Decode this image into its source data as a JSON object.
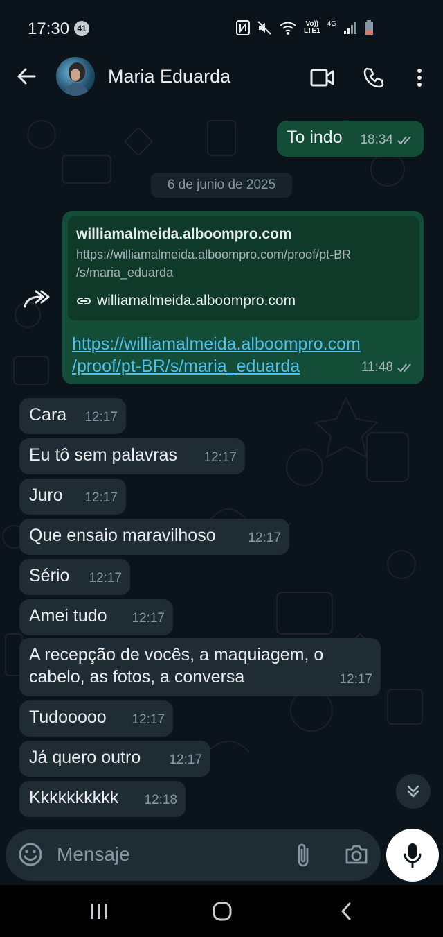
{
  "status": {
    "time": "17:30",
    "badge": "41",
    "lte_top": "Vo))",
    "lte_bottom": "LTE1",
    "net": "4G"
  },
  "header": {
    "contact_name": "Maria Eduarda"
  },
  "date_chip": "6 de junio de 2025",
  "messages": {
    "m0": {
      "text": "To indo",
      "time": "18:34"
    },
    "link": {
      "preview_title": "williamalmeida.alboompro.com",
      "preview_desc_1": "https://williamalmeida.alboompro.com/proof/pt-BR",
      "preview_desc_2": "/s/maria_eduarda",
      "preview_domain": "williamalmeida.alboompro.com",
      "url_line_1": "https://williamalmeida.alboompro.com",
      "url_line_2": "/proof/pt-BR/s/maria_eduarda",
      "time": "11:48"
    },
    "m1": {
      "text": "Cara",
      "time": "12:17"
    },
    "m2": {
      "text": "Eu tô sem palavras",
      "time": "12:17"
    },
    "m3": {
      "text": "Juro",
      "time": "12:17"
    },
    "m4": {
      "text": "Que ensaio maravilhoso",
      "time": "12:17"
    },
    "m5": {
      "text": "Sério",
      "time": "12:17"
    },
    "m6": {
      "text": "Amei tudo",
      "time": "12:17"
    },
    "m7": {
      "line1": "A recepção de vocês, a maquiagem, o",
      "line2": "cabelo, as fotos, a conversa",
      "time": "12:17"
    },
    "m8": {
      "text": "Tudooooo",
      "time": "12:17"
    },
    "m9": {
      "text": "Já quero outro",
      "time": "12:17"
    },
    "m10": {
      "text": "Kkkkkkkkkk",
      "time": "12:18"
    }
  },
  "input": {
    "placeholder": "Mensaje"
  },
  "colors": {
    "outgoing_bubble": "#134d37",
    "incoming_bubble": "#202c33",
    "accent": "#25d366",
    "link": "#53bdeb"
  },
  "icons": [
    "arrow-left-icon",
    "video-call-icon",
    "phone-icon",
    "more-vert-icon",
    "emoji-icon",
    "attach-icon",
    "camera-icon",
    "mic-icon",
    "forward-icon",
    "chevron-double-down-icon",
    "link-icon",
    "double-check-icon"
  ]
}
